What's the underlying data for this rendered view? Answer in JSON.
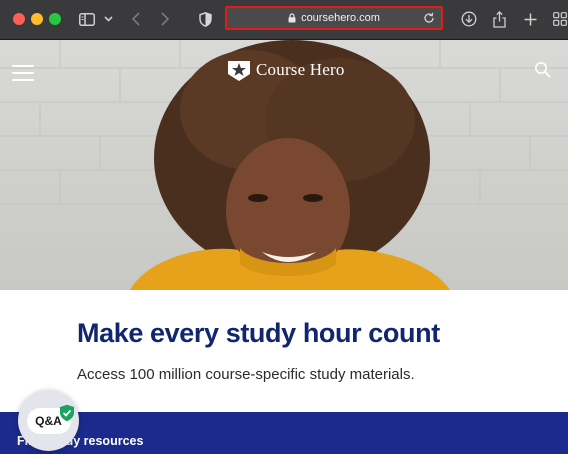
{
  "browser": {
    "url": "coursehero.com",
    "colors": {
      "address_highlight": "#e21b1b",
      "chrome": "#3a3a3c"
    },
    "toolbar_icons": [
      "sidebar-icon",
      "chevron-down-icon",
      "back-icon",
      "forward-icon",
      "shield-icon",
      "lock-icon",
      "reload-icon",
      "download-icon",
      "share-icon",
      "new-tab-icon",
      "tab-overview-icon"
    ]
  },
  "header": {
    "brand": "Course Hero",
    "icons": [
      "menu-icon",
      "star-badge-icon",
      "search-icon"
    ]
  },
  "hero": {
    "headline": "Make every study hour count",
    "subheadline": "Access 100 million course-specific study materials."
  },
  "banner": {
    "text": "Find study resources"
  },
  "qa_widget": {
    "label": "Q&A",
    "icons": [
      "shield-check-icon"
    ]
  },
  "colors": {
    "headline": "#10266e",
    "banner": "#1b2a8c",
    "badge_green": "#1aa260"
  }
}
